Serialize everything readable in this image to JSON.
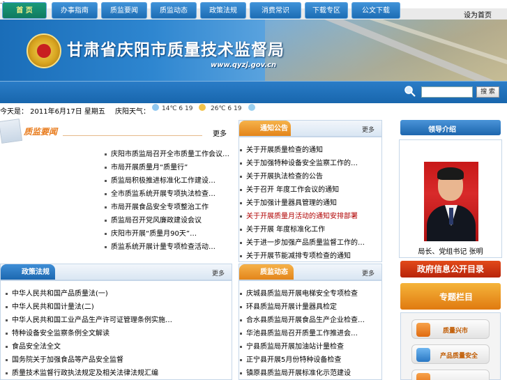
{
  "page": {
    "arrow_text": "->"
  },
  "topbar": {
    "link": "设为首页"
  },
  "banner": {
    "title": "甘肃省庆阳市质量技术监督局",
    "url": "www.qyzj.gov.cn"
  },
  "nav": {
    "items": [
      "首 页",
      "办事指南",
      "质监要闻",
      "质监动态",
      "政策法规",
      "消费常识",
      "下载专区",
      "公文下载"
    ],
    "search_button": "搜 索",
    "search_placeholder": ""
  },
  "infobar": {
    "date": "今天是： 2011年6月17日 星期五",
    "city": "庆阳天气：",
    "weather1": "14℃ 6 19",
    "weather2": "26℃ 6 19"
  },
  "news": {
    "title": "质监要闻",
    "more": "更多",
    "items": [
      "庆阳市质监局召开全市质量工作会议…",
      "市局开展质量月“质量行”",
      "质监局积极推进标准化工作建设…",
      "全市质监系统开展专项执法检查…",
      "市局开展食品安全专项整治工作",
      "质监局召开党风廉政建设会议",
      "庆阳市开展“质量月90天”…",
      "质监系统开展计量专项检查活动…"
    ]
  },
  "notice": {
    "title": "通知公告",
    "more": "更多",
    "items": [
      {
        "text": "关于开展质量检查的通知",
        "red": false
      },
      {
        "text": "关于加强特种设备安全监察工作的…",
        "red": false
      },
      {
        "text": "关于开展执法检查的公告",
        "red": false
      },
      {
        "text": "关于召开 年度工作会议的通知",
        "red": false
      },
      {
        "text": "关于加强计量器具管理的通知",
        "red": false
      },
      {
        "text": "关于开展质量月活动的通知安排部署",
        "red": true
      },
      {
        "text": "关于开展 年度标准化工作",
        "red": false
      },
      {
        "text": "关于进一步加强产品质量监督工作的…",
        "red": false
      },
      {
        "text": "关于开展节能减排专项检查的通知",
        "red": false
      }
    ]
  },
  "leader": {
    "title": "领导介绍",
    "caption": "局长、党组书记 张明"
  },
  "policy": {
    "title": "政策法规",
    "more": "更多",
    "items": [
      "中华人民共和国产品质量法(一)",
      "中华人民共和国计量法(二)",
      "中华人民共和国工业产品生产许可证管理条例实施…",
      "特种设备安全监察条例全文解读",
      "食品安全法全文",
      "国务院关于加强食品等产品安全监督",
      "质量技术监督行政执法规定及相关法律法规汇编"
    ]
  },
  "dynamics": {
    "title": "质监动态",
    "more": "更多",
    "items": [
      "庆城县质监局开展电梯安全专项检查",
      "环县质监局开展计量器具检定",
      "合水县质监局开展食品生产企业检查…",
      "华池县质监局召开质量工作推进会…",
      "宁县质监局开展加油站计量检查",
      "正宁县开展5月份特种设备检查",
      "镇原县质监局开展标准化示范建设"
    ]
  },
  "sidebar": {
    "open_gov": "政府信息公开目录",
    "special": "专题栏目",
    "btn1": "质量兴市",
    "btn2": "产品质量安全"
  }
}
